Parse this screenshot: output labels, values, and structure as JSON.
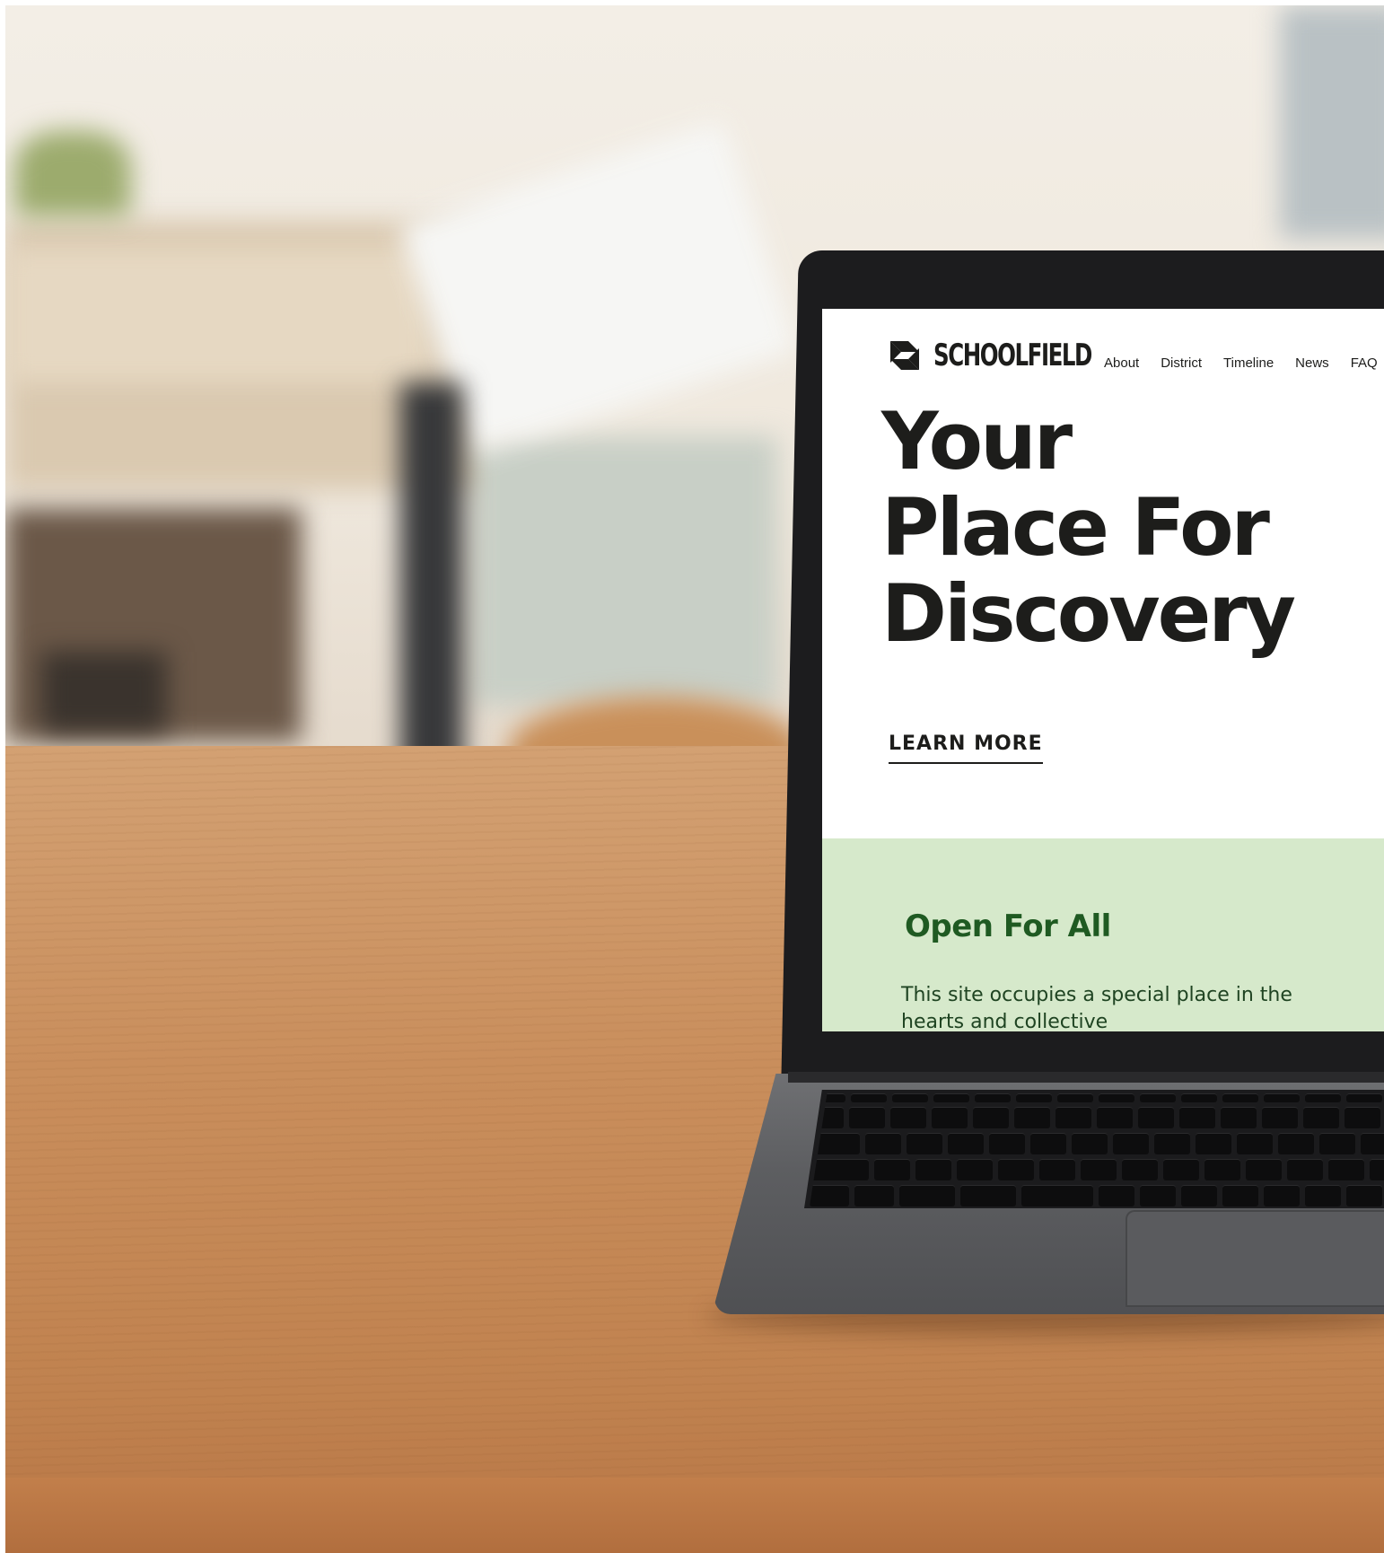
{
  "site": {
    "logo_text": "SCHOOLFIELD",
    "nav": [
      "About",
      "District",
      "Timeline",
      "News",
      "FAQ"
    ],
    "hero_lines": [
      "Your",
      "Place For",
      "Discovery"
    ],
    "cta_label": "LEARN MORE",
    "section_title": "Open For All",
    "section_body": "This site occupies a special place in the hearts and collective"
  },
  "colors": {
    "text_dark": "#1d1d1b",
    "accent_green": "#1f5a22",
    "section_bg": "#d6e9cb"
  },
  "icons": {
    "logo": "s-monogram-icon"
  }
}
